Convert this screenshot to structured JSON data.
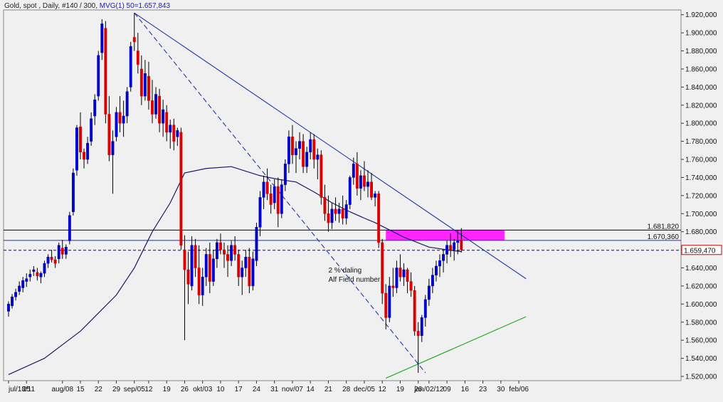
{
  "header": {
    "prefix": "Gold, spot , Daily, #140 / 300,",
    "ma_label": "MVG(1) 50=1.657,843"
  },
  "colors": {
    "background": "#f0f0f0",
    "up_candle": "#0000cc",
    "down_candle": "#dd0000",
    "trendline": "#2233aa",
    "moving_average": "#1a1a66",
    "support_line": "#22aa22",
    "highlight_zone": "#ff00ff",
    "price_line": "#0000aa"
  },
  "chart_data": {
    "type": "candlestick",
    "title": "Gold, spot , Daily, #140 / 300,",
    "ylim": [
      1520,
      1930
    ],
    "y_ticks": [
      {
        "value": 1920,
        "label": "1.920,000"
      },
      {
        "value": 1900,
        "label": "1.900,000"
      },
      {
        "value": 1880,
        "label": "1.880,000"
      },
      {
        "value": 1860,
        "label": "1.860,000"
      },
      {
        "value": 1840,
        "label": "1.840,000"
      },
      {
        "value": 1820,
        "label": "1.820,000"
      },
      {
        "value": 1800,
        "label": "1.800,000"
      },
      {
        "value": 1780,
        "label": "1.780,000"
      },
      {
        "value": 1760,
        "label": "1.760,000"
      },
      {
        "value": 1740,
        "label": "1.740,000"
      },
      {
        "value": 1720,
        "label": "1.720,000"
      },
      {
        "value": 1700,
        "label": "1.700,000"
      },
      {
        "value": 1680,
        "label": "1.680,000"
      },
      {
        "value": 1660,
        "label": "1.660,000"
      },
      {
        "value": 1640,
        "label": "1.640,000"
      },
      {
        "value": 1620,
        "label": "1.620,000"
      },
      {
        "value": 1600,
        "label": "1.600,000"
      },
      {
        "value": 1580,
        "label": "1.580,000"
      },
      {
        "value": 1560,
        "label": "1.560,000"
      },
      {
        "value": 1540,
        "label": "1.540,000"
      },
      {
        "value": 1520,
        "label": "1.520,000"
      }
    ],
    "x_ticks": [
      {
        "index": 0,
        "label": "jul/18/11"
      },
      {
        "index": 5,
        "label": "25"
      },
      {
        "index": 15,
        "label": "aug/08"
      },
      {
        "index": 20,
        "label": "15"
      },
      {
        "index": 25,
        "label": "22"
      },
      {
        "index": 30,
        "label": "29"
      },
      {
        "index": 35,
        "label": "sep/05"
      },
      {
        "index": 39,
        "label": "12"
      },
      {
        "index": 44,
        "label": "19"
      },
      {
        "index": 49,
        "label": "26"
      },
      {
        "index": 54,
        "label": "okt/03"
      },
      {
        "index": 59,
        "label": "10"
      },
      {
        "index": 64,
        "label": "17"
      },
      {
        "index": 69,
        "label": "24"
      },
      {
        "index": 74,
        "label": "31"
      },
      {
        "index": 79,
        "label": "nov/07"
      },
      {
        "index": 84,
        "label": "14"
      },
      {
        "index": 89,
        "label": "21"
      },
      {
        "index": 94,
        "label": "28"
      },
      {
        "index": 99,
        "label": "dec/05"
      },
      {
        "index": 104,
        "label": "12"
      },
      {
        "index": 109,
        "label": "19"
      },
      {
        "index": 114,
        "label": "26"
      },
      {
        "index": 117,
        "label": "jan/02/12"
      },
      {
        "index": 122,
        "label": "09"
      },
      {
        "index": 127,
        "label": "16"
      },
      {
        "index": 132,
        "label": "23"
      },
      {
        "index": 137,
        "label": "30"
      },
      {
        "index": 142,
        "label": "feb/06"
      }
    ],
    "candles": [
      [
        1592,
        1603,
        1586,
        1600
      ],
      [
        1598,
        1611,
        1595,
        1608
      ],
      [
        1608,
        1617,
        1604,
        1613
      ],
      [
        1614,
        1625,
        1610,
        1620
      ],
      [
        1618,
        1630,
        1613,
        1626
      ],
      [
        1625,
        1634,
        1619,
        1628
      ],
      [
        1630,
        1638,
        1625,
        1633
      ],
      [
        1636,
        1642,
        1631,
        1638
      ],
      [
        1635,
        1640,
        1626,
        1631
      ],
      [
        1630,
        1636,
        1623,
        1634
      ],
      [
        1634,
        1648,
        1630,
        1645
      ],
      [
        1645,
        1655,
        1640,
        1652
      ],
      [
        1652,
        1660,
        1646,
        1649
      ],
      [
        1649,
        1653,
        1640,
        1645
      ],
      [
        1650,
        1668,
        1645,
        1665
      ],
      [
        1662,
        1671,
        1650,
        1655
      ],
      [
        1655,
        1666,
        1650,
        1663
      ],
      [
        1670,
        1702,
        1666,
        1698
      ],
      [
        1702,
        1750,
        1698,
        1745
      ],
      [
        1748,
        1798,
        1742,
        1795
      ],
      [
        1796,
        1812,
        1760,
        1768
      ],
      [
        1768,
        1772,
        1750,
        1760
      ],
      [
        1760,
        1785,
        1755,
        1778
      ],
      [
        1780,
        1812,
        1775,
        1805
      ],
      [
        1808,
        1832,
        1798,
        1826
      ],
      [
        1830,
        1880,
        1825,
        1875
      ],
      [
        1878,
        1915,
        1870,
        1910
      ],
      [
        1905,
        1913,
        1800,
        1810
      ],
      [
        1810,
        1830,
        1758,
        1765
      ],
      [
        1765,
        1792,
        1722,
        1780
      ],
      [
        1785,
        1818,
        1780,
        1812
      ],
      [
        1812,
        1830,
        1790,
        1800
      ],
      [
        1800,
        1825,
        1785,
        1808
      ],
      [
        1808,
        1840,
        1800,
        1835
      ],
      [
        1840,
        1890,
        1835,
        1885
      ],
      [
        1895,
        1922,
        1880,
        1890
      ],
      [
        1880,
        1900,
        1855,
        1865
      ],
      [
        1860,
        1875,
        1820,
        1830
      ],
      [
        1830,
        1870,
        1825,
        1855
      ],
      [
        1852,
        1868,
        1815,
        1825
      ],
      [
        1825,
        1848,
        1800,
        1810
      ],
      [
        1810,
        1840,
        1805,
        1832
      ],
      [
        1830,
        1838,
        1790,
        1800
      ],
      [
        1800,
        1826,
        1785,
        1815
      ],
      [
        1812,
        1820,
        1780,
        1790
      ],
      [
        1790,
        1804,
        1772,
        1798
      ],
      [
        1798,
        1805,
        1770,
        1780
      ],
      [
        1785,
        1795,
        1775,
        1792
      ],
      [
        1790,
        1795,
        1660,
        1665
      ],
      [
        1660,
        1676,
        1560,
        1638
      ],
      [
        1638,
        1658,
        1600,
        1622
      ],
      [
        1620,
        1675,
        1615,
        1665
      ],
      [
        1665,
        1672,
        1630,
        1640
      ],
      [
        1640,
        1665,
        1600,
        1610
      ],
      [
        1610,
        1640,
        1598,
        1630
      ],
      [
        1630,
        1662,
        1620,
        1655
      ],
      [
        1655,
        1668,
        1612,
        1625
      ],
      [
        1625,
        1660,
        1620,
        1650
      ],
      [
        1650,
        1672,
        1640,
        1668
      ],
      [
        1668,
        1678,
        1655,
        1660
      ],
      [
        1660,
        1668,
        1640,
        1655
      ],
      [
        1655,
        1665,
        1630,
        1648
      ],
      [
        1648,
        1670,
        1642,
        1665
      ],
      [
        1665,
        1675,
        1648,
        1655
      ],
      [
        1655,
        1660,
        1620,
        1630
      ],
      [
        1630,
        1648,
        1610,
        1640
      ],
      [
        1640,
        1660,
        1630,
        1652
      ],
      [
        1652,
        1662,
        1612,
        1620
      ],
      [
        1620,
        1658,
        1615,
        1650
      ],
      [
        1648,
        1690,
        1642,
        1685
      ],
      [
        1685,
        1725,
        1675,
        1718
      ],
      [
        1718,
        1742,
        1705,
        1735
      ],
      [
        1735,
        1750,
        1715,
        1722
      ],
      [
        1722,
        1732,
        1700,
        1710
      ],
      [
        1712,
        1738,
        1705,
        1730
      ],
      [
        1730,
        1740,
        1685,
        1700
      ],
      [
        1700,
        1738,
        1695,
        1732
      ],
      [
        1732,
        1760,
        1725,
        1755
      ],
      [
        1755,
        1792,
        1745,
        1785
      ],
      [
        1785,
        1798,
        1755,
        1765
      ],
      [
        1765,
        1780,
        1745,
        1772
      ],
      [
        1772,
        1790,
        1760,
        1780
      ],
      [
        1780,
        1788,
        1745,
        1752
      ],
      [
        1752,
        1774,
        1745,
        1768
      ],
      [
        1768,
        1790,
        1760,
        1782
      ],
      [
        1782,
        1788,
        1750,
        1760
      ],
      [
        1760,
        1772,
        1738,
        1765
      ],
      [
        1765,
        1770,
        1710,
        1718
      ],
      [
        1718,
        1732,
        1692,
        1700
      ],
      [
        1700,
        1720,
        1680,
        1690
      ],
      [
        1690,
        1712,
        1683,
        1705
      ],
      [
        1705,
        1718,
        1692,
        1700
      ],
      [
        1700,
        1712,
        1690,
        1705
      ],
      [
        1705,
        1720,
        1688,
        1695
      ],
      [
        1695,
        1715,
        1688,
        1710
      ],
      [
        1710,
        1742,
        1705,
        1740
      ],
      [
        1740,
        1762,
        1732,
        1755
      ],
      [
        1755,
        1768,
        1720,
        1728
      ],
      [
        1728,
        1748,
        1715,
        1742
      ],
      [
        1742,
        1758,
        1725,
        1730
      ],
      [
        1730,
        1748,
        1718,
        1735
      ],
      [
        1735,
        1745,
        1715,
        1718
      ],
      [
        1718,
        1725,
        1708,
        1722
      ],
      [
        1722,
        1725,
        1662,
        1668
      ],
      [
        1668,
        1672,
        1600,
        1612
      ],
      [
        1612,
        1622,
        1572,
        1585
      ],
      [
        1585,
        1630,
        1580,
        1620
      ],
      [
        1620,
        1640,
        1608,
        1618
      ],
      [
        1618,
        1648,
        1612,
        1640
      ],
      [
        1640,
        1655,
        1625,
        1630
      ],
      [
        1630,
        1645,
        1620,
        1638
      ],
      [
        1638,
        1640,
        1612,
        1625
      ],
      [
        1625,
        1635,
        1608,
        1615
      ],
      [
        1615,
        1620,
        1565,
        1570
      ],
      [
        1570,
        1580,
        1524,
        1565
      ],
      [
        1565,
        1588,
        1558,
        1585
      ],
      [
        1585,
        1610,
        1575,
        1605
      ],
      [
        1605,
        1628,
        1598,
        1620
      ],
      [
        1620,
        1640,
        1612,
        1632
      ],
      [
        1632,
        1648,
        1625,
        1642
      ],
      [
        1642,
        1655,
        1630,
        1648
      ],
      [
        1648,
        1660,
        1635,
        1655
      ],
      [
        1655,
        1670,
        1645,
        1665
      ],
      [
        1665,
        1678,
        1652,
        1660
      ],
      [
        1660,
        1672,
        1648,
        1668
      ],
      [
        1668,
        1682,
        1655,
        1670
      ],
      [
        1670,
        1684,
        1657,
        1660
      ]
    ],
    "moving_average": {
      "name": "MVG(1) 50",
      "points": [
        [
          0,
          1522
        ],
        [
          10,
          1540
        ],
        [
          20,
          1570
        ],
        [
          30,
          1610
        ],
        [
          35,
          1640
        ],
        [
          40,
          1680
        ],
        [
          45,
          1712
        ],
        [
          49,
          1745
        ],
        [
          55,
          1750
        ],
        [
          62,
          1752
        ],
        [
          70,
          1742
        ],
        [
          75,
          1738
        ],
        [
          80,
          1735
        ],
        [
          85,
          1724
        ],
        [
          90,
          1712
        ],
        [
          95,
          1702
        ],
        [
          99,
          1695
        ],
        [
          102,
          1690
        ],
        [
          110,
          1674
        ],
        [
          117,
          1663
        ],
        [
          122,
          1660
        ],
        [
          126,
          1658
        ]
      ]
    },
    "trendlines": [
      {
        "name": "solid-downtrend",
        "from": [
          35,
          1922
        ],
        "to": [
          144,
          1628
        ],
        "dashed": false
      },
      {
        "name": "dashed-downtrend",
        "from": [
          35,
          1922
        ],
        "to": [
          116,
          1524
        ],
        "dashed": true
      }
    ],
    "support_line": {
      "from": [
        105,
        1518
      ],
      "to": [
        144,
        1586
      ]
    },
    "horizontal_levels": [
      {
        "value": 1681.82,
        "label": "1.681,820",
        "style": "solid",
        "color": "#000044"
      },
      {
        "value": 1670.36,
        "label": "1.670,360",
        "style": "solid",
        "color": "#2233aa"
      },
      {
        "value": 1659.47,
        "label": "1.659,470",
        "style": "dashed",
        "color": "#0000aa",
        "boxed": true
      }
    ],
    "highlight_zone": {
      "x_start": 105,
      "x_end": 138,
      "y_low": 1670.36,
      "y_high": 1681.82
    },
    "annotation": {
      "lines": [
        "2 % daling",
        "Alf Field number"
      ],
      "x": 89,
      "y": 1635
    }
  }
}
